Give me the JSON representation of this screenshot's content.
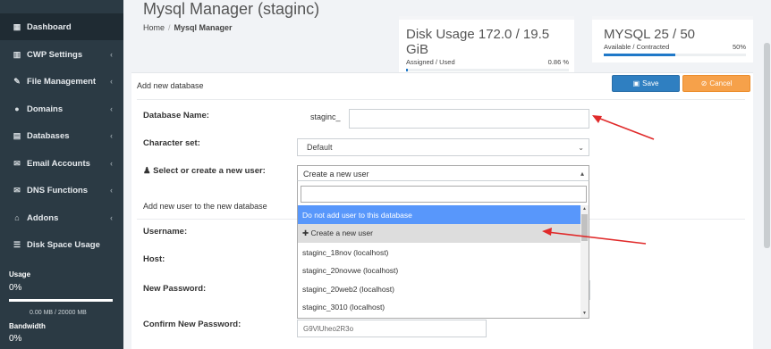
{
  "sidebar": {
    "items": [
      {
        "label": "Dashboard",
        "icon": "dashboard-icon",
        "glyph": "▦",
        "chevron": false
      },
      {
        "label": "CWP Settings",
        "icon": "bar-chart-icon",
        "glyph": "▥",
        "chevron": true
      },
      {
        "label": "File Management",
        "icon": "edit-icon",
        "glyph": "✎",
        "chevron": true
      },
      {
        "label": "Domains",
        "icon": "globe-icon",
        "glyph": "●",
        "chevron": true
      },
      {
        "label": "Databases",
        "icon": "calendar-icon",
        "glyph": "▤",
        "chevron": true
      },
      {
        "label": "Email Accounts",
        "icon": "envelope-icon",
        "glyph": "✉",
        "chevron": true
      },
      {
        "label": "DNS Functions",
        "icon": "envelope-icon",
        "glyph": "✉",
        "chevron": true
      },
      {
        "label": "Addons",
        "icon": "bank-icon",
        "glyph": "⌂",
        "chevron": true
      },
      {
        "label": "Disk Space Usage",
        "icon": "list-icon",
        "glyph": "☰",
        "chevron": false
      }
    ],
    "chevron_glyph": "‹",
    "usage_label": "Usage",
    "usage_pct": "0%",
    "usage_mb": "0.00 MB / 20000 MB",
    "bandwidth_label": "Bandwidth",
    "bandwidth_pct": "0%"
  },
  "header": {
    "title": "Mysql Manager (staginc)",
    "crumb_home": "Home",
    "crumb_sep": "/",
    "crumb_current": "Mysql Manager"
  },
  "cards": {
    "disk": {
      "title": "Disk Usage 172.0 / 19.5",
      "title2": "GiB",
      "sub": "Assigned / Used",
      "pct": "0.86 %",
      "fill": 0.0086
    },
    "mysql": {
      "title": "MYSQL 25 / 50",
      "sub": "Available / Contracted",
      "pct": "50%",
      "fill": 0.5
    }
  },
  "form": {
    "heading": "Add new database",
    "save_label": "Save",
    "save_icon": "▣",
    "cancel_label": "Cancel",
    "cancel_icon": "⊘",
    "db_name_label": "Database Name:",
    "db_prefix": "staginc_",
    "db_name_value": "",
    "charset_label": "Character set:",
    "charset_value": "Default",
    "user_label": "Select or create a new user:",
    "user_icon": "♟",
    "user_value": "Create a new user",
    "new_user_heading": "Add new user to the new database",
    "username_label": "Username:",
    "host_label": "Host:",
    "password_label": "New Password:",
    "confirm_label": "Confirm New Password:",
    "confirm_value": "G9VlUheo2R3o"
  },
  "dropdown": {
    "search_value": "",
    "options": [
      {
        "label": "Do not add user to this database",
        "state": "highlighted"
      },
      {
        "label": "✚ Create a new user",
        "state": "selected"
      },
      {
        "label": "staginc_18nov (localhost)",
        "state": "normal"
      },
      {
        "label": "staginc_20novwe (localhost)",
        "state": "normal"
      },
      {
        "label": "staginc_20web2 (localhost)",
        "state": "normal"
      },
      {
        "label": "staginc_3010 (localhost)",
        "state": "normal"
      }
    ]
  },
  "colors": {
    "sidebar": "#2b3a44",
    "primary": "#2f7fc1",
    "warning": "#f6a14a",
    "highlight": "#5897fb",
    "annotation_arrow": "#e02a2a"
  }
}
